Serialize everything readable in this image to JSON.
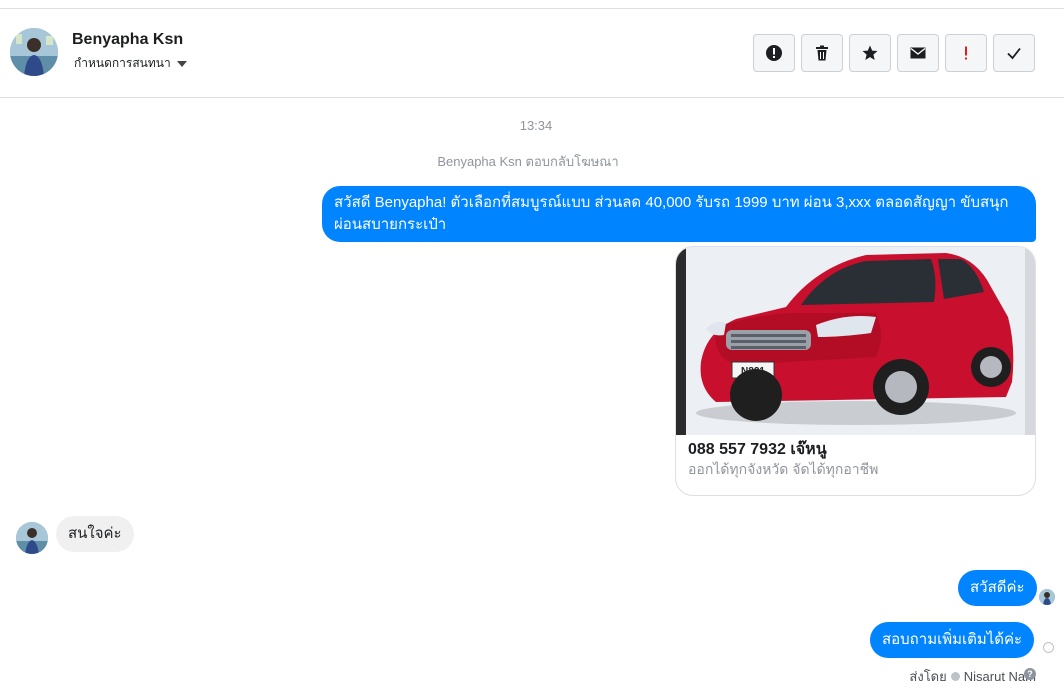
{
  "header": {
    "contact_name": "Benyapha Ksn",
    "label_dropdown": "กำหนดการสนทนา",
    "toolbar": [
      {
        "name": "spam-info-button",
        "icon": "alert-circle-icon"
      },
      {
        "name": "delete-button",
        "icon": "trash-icon"
      },
      {
        "name": "star-button",
        "icon": "star-icon"
      },
      {
        "name": "mark-unread-button",
        "icon": "envelope-icon"
      },
      {
        "name": "mark-important-button",
        "icon": "exclamation-icon"
      },
      {
        "name": "mark-done-button",
        "icon": "checkmark-icon"
      }
    ]
  },
  "conversation": {
    "timestamp": "13:34",
    "reply_note": "Benyapha Ksn ตอบกลับโฆษณา",
    "messages": [
      {
        "from": "page",
        "text": "สวัสดี Benyapha! ตัวเลือกที่สมบูรณ์แบบ ส่วนลด 40,000 รับรถ 1999 บาท ผ่อน 3,xxx ตลอดสัญญา ขับสนุก ผ่อนสบายกระเป๋า"
      },
      {
        "from": "page",
        "type": "ad_card",
        "title": "088 557 7932 เจ๊หนู",
        "subtitle": "ออกได้ทุกจังหวัด จัดได้ทุกอาชีพ",
        "image_plate": "N821"
      },
      {
        "from": "user",
        "text": "สนใจค่ะ"
      },
      {
        "from": "page",
        "text": "สวัสดีค่ะ"
      },
      {
        "from": "page",
        "text": "สอบถามเพิ่มเติมได้ค่ะ"
      }
    ],
    "sent_by_prefix": "ส่งโดย",
    "sent_by_name": "Nisarut Nam"
  },
  "colors": {
    "accent": "#0084ff",
    "incoming_bubble": "#f1f0f0",
    "muted_text": "#90949c",
    "important": "#e02020"
  }
}
